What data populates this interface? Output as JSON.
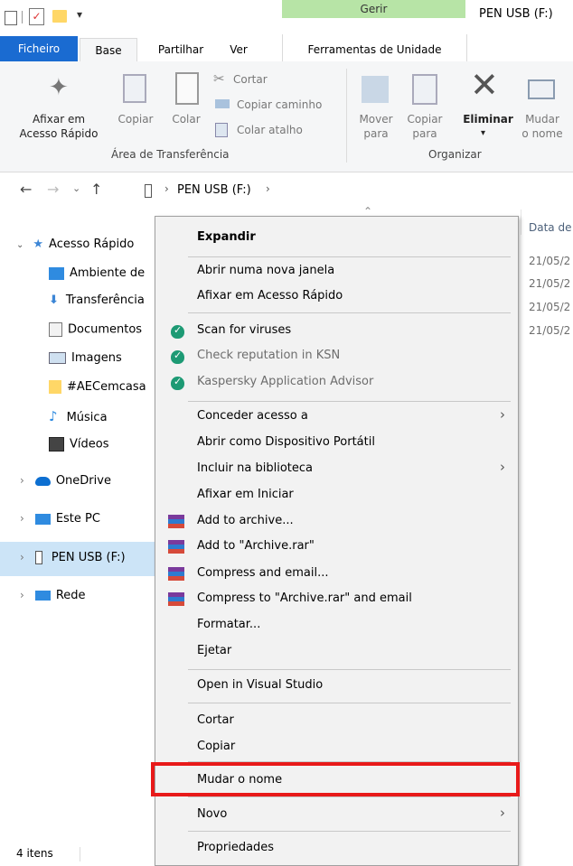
{
  "window": {
    "title": "PEN USB (F:)",
    "context_tab": "Gerir"
  },
  "ribbon_tabs": {
    "file": "Ficheiro",
    "home": "Base",
    "share": "Partilhar",
    "view": "Ver",
    "drive_tools": "Ferramentas de Unidade"
  },
  "ribbon": {
    "pin_quick_access": "Afixar em\nAcesso Rápido",
    "copy": "Copiar",
    "paste": "Colar",
    "cut": "Cortar",
    "copy_path": "Copiar caminho",
    "paste_shortcut": "Colar atalho",
    "clipboard_group": "Área de Transferência",
    "move_to": "Mover\npara",
    "copy_to": "Copiar\npara",
    "delete": "Eliminar",
    "rename": "Mudar\no nome",
    "organize_group": "Organizar"
  },
  "address": {
    "path": "PEN USB (F:)"
  },
  "columns": {
    "date": "Data de"
  },
  "dates": [
    "21/05/2",
    "21/05/2",
    "21/05/2",
    "21/05/2"
  ],
  "nav": [
    {
      "label": "Acesso Rápido",
      "icon": "star-icon"
    },
    {
      "label": "Ambiente de",
      "icon": "desktop-icon"
    },
    {
      "label": "Transferência",
      "icon": "download-icon"
    },
    {
      "label": "Documentos",
      "icon": "documents-icon"
    },
    {
      "label": "Imagens",
      "icon": "pictures-icon"
    },
    {
      "label": "#AECemcasa",
      "icon": "folder-icon"
    },
    {
      "label": "Música",
      "icon": "music-icon"
    },
    {
      "label": "Vídeos",
      "icon": "video-icon"
    },
    {
      "label": "OneDrive",
      "icon": "cloud-icon"
    },
    {
      "label": "Este PC",
      "icon": "computer-icon"
    },
    {
      "label": "PEN USB (F:)",
      "icon": "usb-drive-icon"
    },
    {
      "label": "Rede",
      "icon": "network-icon"
    }
  ],
  "menu": {
    "expand": "Expandir",
    "open_new_window": "Abrir numa nova janela",
    "pin_quick": "Afixar em Acesso Rápido",
    "scan": "Scan for viruses",
    "reputation": "Check reputation in KSN",
    "advisor": "Kaspersky Application Advisor",
    "give_access": "Conceder acesso a",
    "open_portable": "Abrir como Dispositivo Portátil",
    "include_library": "Incluir na biblioteca",
    "pin_start": "Afixar em Iniciar",
    "add_archive": "Add to archive...",
    "add_archive_rar": "Add to \"Archive.rar\"",
    "compress_email": "Compress and email...",
    "compress_rar_email": "Compress to \"Archive.rar\" and email",
    "format": "Formatar...",
    "eject": "Ejetar",
    "open_vs": "Open in Visual Studio",
    "cut": "Cortar",
    "copy": "Copiar",
    "rename": "Mudar o nome",
    "new": "Novo",
    "properties": "Propriedades"
  },
  "status": {
    "items": "4 itens"
  },
  "colors": {
    "file_tab": "#1a6bd1",
    "context_tab": "#b7e4a6",
    "highlight": "#e81a1a",
    "kaspersky": "#1d9a74"
  }
}
